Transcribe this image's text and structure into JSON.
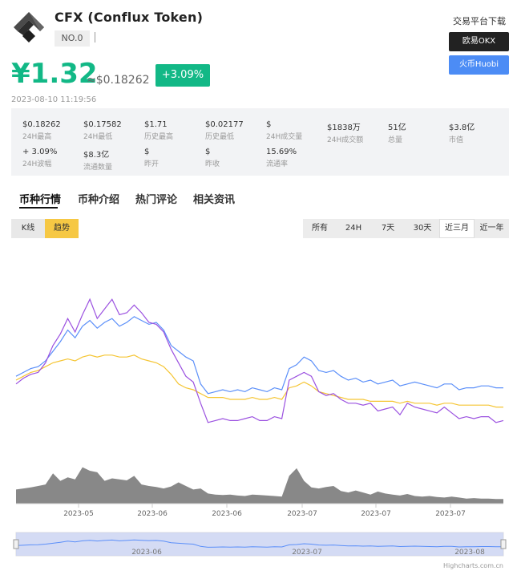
{
  "coin": {
    "title": "CFX (Conflux Token)",
    "rank": "NO.0",
    "price_cny": "¥1.32",
    "price_usd": "≈$0.18262",
    "change": "+3.09%",
    "timestamp": "2023-08-10 11:19:56"
  },
  "exchanges": {
    "title": "交易平台下载",
    "okx": "欧易OKX",
    "huobi": "火币Huobi"
  },
  "stats": [
    {
      "value": "$0.18262",
      "label": "24H最高"
    },
    {
      "value": "$0.17582",
      "label": "24H最低"
    },
    {
      "value": "$1.71",
      "label": "历史最高"
    },
    {
      "value": "$0.02177",
      "label": "历史最低"
    },
    {
      "value": "$",
      "label": "24H成交量"
    },
    {
      "value": "$1838万",
      "label": "24H成交额"
    },
    {
      "value": "51亿",
      "label": "总量"
    },
    {
      "value": "$3.8亿",
      "label": "市值"
    },
    {
      "value": "+ 3.09%",
      "label": "24H波幅"
    },
    {
      "value": "$8.3亿",
      "label": "流通数量"
    },
    {
      "value": "$",
      "label": "昨开"
    },
    {
      "value": "$",
      "label": "昨收"
    },
    {
      "value": "15.69%",
      "label": "流通率"
    }
  ],
  "tabs": [
    "币种行情",
    "币种介绍",
    "热门评论",
    "相关资讯"
  ],
  "chart_controls": {
    "modes": [
      "K线",
      "趋势"
    ],
    "ranges": [
      "所有",
      "24H",
      "7天",
      "30天",
      "近三月",
      "近一年"
    ],
    "active_range": "近三月"
  },
  "colors": {
    "up": "#12b886",
    "price_line": "#5b8ff9",
    "series_yellow": "#f5c533",
    "series_purple": "#9b51e0",
    "volume": "#888888",
    "navigator": "#c6cff0"
  },
  "chart_data": {
    "type": "line",
    "x_tick_labels": [
      "2023-05",
      "2023-06",
      "2023-06",
      "2023-07",
      "2023-07",
      "2023-07"
    ],
    "navigator_tick_labels": [
      "2023-06",
      "2023-07",
      "2023-08"
    ],
    "credit": "Highcharts.com.cn",
    "series": [
      {
        "color": "#5b8ff9",
        "values": [
          0.42,
          0.44,
          0.46,
          0.47,
          0.5,
          0.55,
          0.6,
          0.66,
          0.62,
          0.68,
          0.71,
          0.67,
          0.7,
          0.72,
          0.68,
          0.7,
          0.73,
          0.71,
          0.69,
          0.7,
          0.66,
          0.58,
          0.55,
          0.52,
          0.5,
          0.38,
          0.33,
          0.34,
          0.35,
          0.34,
          0.35,
          0.34,
          0.36,
          0.35,
          0.34,
          0.36,
          0.35,
          0.46,
          0.48,
          0.52,
          0.5,
          0.45,
          0.44,
          0.45,
          0.42,
          0.4,
          0.41,
          0.39,
          0.4,
          0.38,
          0.39,
          0.4,
          0.37,
          0.38,
          0.39,
          0.38,
          0.37,
          0.36,
          0.38,
          0.38,
          0.35,
          0.36,
          0.36,
          0.37,
          0.37,
          0.36,
          0.36
        ]
      },
      {
        "color": "#f5c533",
        "values": [
          0.4,
          0.42,
          0.44,
          0.45,
          0.47,
          0.49,
          0.5,
          0.51,
          0.5,
          0.52,
          0.53,
          0.52,
          0.53,
          0.53,
          0.52,
          0.52,
          0.53,
          0.51,
          0.5,
          0.49,
          0.47,
          0.43,
          0.38,
          0.36,
          0.35,
          0.33,
          0.31,
          0.31,
          0.31,
          0.3,
          0.3,
          0.3,
          0.31,
          0.3,
          0.3,
          0.31,
          0.3,
          0.36,
          0.37,
          0.39,
          0.37,
          0.34,
          0.33,
          0.32,
          0.31,
          0.3,
          0.3,
          0.3,
          0.29,
          0.29,
          0.29,
          0.29,
          0.28,
          0.29,
          0.28,
          0.28,
          0.28,
          0.27,
          0.28,
          0.28,
          0.27,
          0.27,
          0.27,
          0.27,
          0.27,
          0.26,
          0.26
        ]
      },
      {
        "color": "#9b51e0",
        "values": [
          0.38,
          0.41,
          0.43,
          0.44,
          0.49,
          0.58,
          0.64,
          0.72,
          0.65,
          0.74,
          0.82,
          0.72,
          0.77,
          0.82,
          0.74,
          0.75,
          0.79,
          0.75,
          0.7,
          0.69,
          0.65,
          0.56,
          0.49,
          0.42,
          0.39,
          0.28,
          0.18,
          0.19,
          0.2,
          0.19,
          0.19,
          0.2,
          0.21,
          0.19,
          0.19,
          0.21,
          0.2,
          0.4,
          0.42,
          0.44,
          0.42,
          0.34,
          0.32,
          0.33,
          0.3,
          0.28,
          0.28,
          0.27,
          0.28,
          0.24,
          0.25,
          0.26,
          0.22,
          0.28,
          0.26,
          0.25,
          0.24,
          0.23,
          0.26,
          0.23,
          0.2,
          0.21,
          0.2,
          0.21,
          0.21,
          0.18,
          0.19
        ]
      }
    ],
    "volume": [
      0.28,
      0.3,
      0.32,
      0.35,
      0.38,
      0.6,
      0.45,
      0.52,
      0.48,
      0.72,
      0.65,
      0.62,
      0.45,
      0.5,
      0.48,
      0.46,
      0.55,
      0.38,
      0.35,
      0.33,
      0.3,
      0.34,
      0.42,
      0.35,
      0.28,
      0.3,
      0.2,
      0.18,
      0.17,
      0.18,
      0.16,
      0.15,
      0.18,
      0.17,
      0.16,
      0.15,
      0.14,
      0.55,
      0.7,
      0.45,
      0.32,
      0.3,
      0.33,
      0.35,
      0.25,
      0.22,
      0.26,
      0.22,
      0.18,
      0.24,
      0.2,
      0.18,
      0.16,
      0.19,
      0.15,
      0.14,
      0.15,
      0.13,
      0.12,
      0.14,
      0.12,
      0.1,
      0.11,
      0.1,
      0.1,
      0.09,
      0.09
    ]
  }
}
